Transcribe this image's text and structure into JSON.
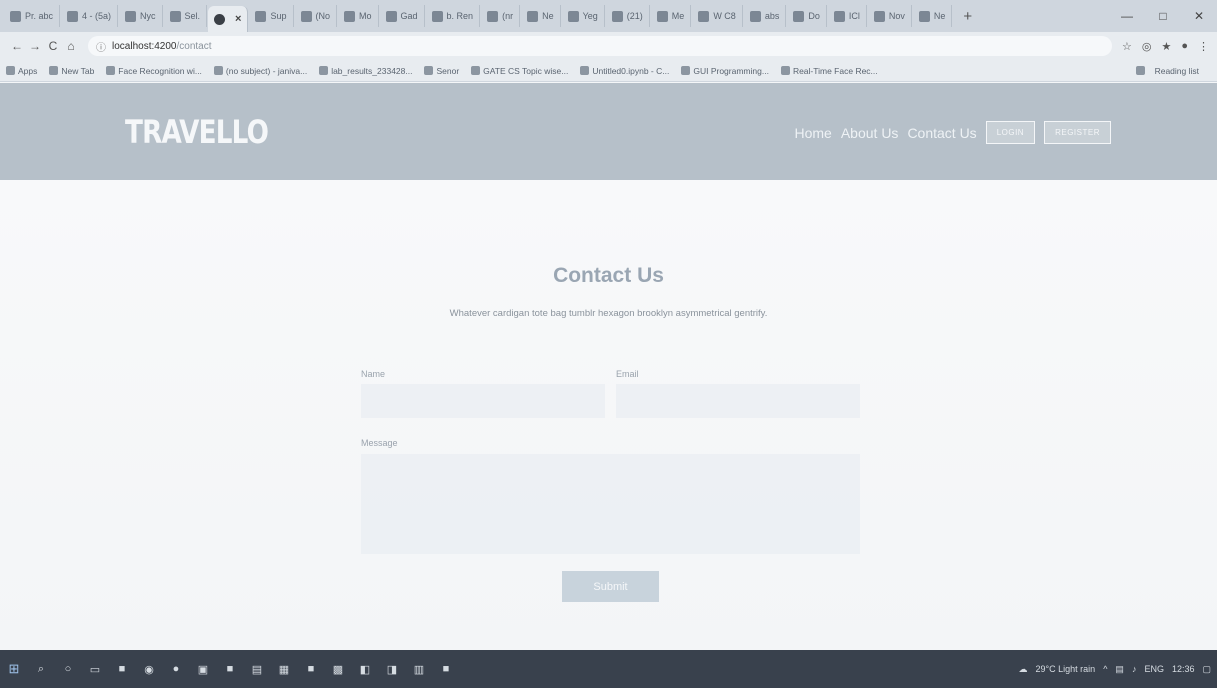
{
  "browser": {
    "tabs": [
      {
        "label": "Pr. abc"
      },
      {
        "label": "4 - (5a)"
      },
      {
        "label": "Nyc"
      },
      {
        "label": "Sel."
      },
      {
        "label": "",
        "active": true,
        "close": "×"
      },
      {
        "label": "Sup"
      },
      {
        "label": "(No"
      },
      {
        "label": "Mo"
      },
      {
        "label": "Gad"
      },
      {
        "label": "b. Ren"
      },
      {
        "label": "(nr"
      },
      {
        "label": "Ne"
      },
      {
        "label": "Yeg"
      },
      {
        "label": "(21)"
      },
      {
        "label": "Me"
      },
      {
        "label": "W C8"
      },
      {
        "label": "abs"
      },
      {
        "label": "Do"
      },
      {
        "label": "ICl"
      },
      {
        "label": "Nov"
      },
      {
        "label": "Ne"
      }
    ],
    "new_tab": "+",
    "window_controls": {
      "minimize": "—",
      "maximize": "□",
      "close": "✕"
    },
    "nav": {
      "back": "←",
      "forward": "→",
      "reload": "C",
      "home": "⌂"
    },
    "url_host": "localhost:4200",
    "url_path": "/contact",
    "bookmarks": [
      "Apps",
      "New Tab",
      "Face Recognition wi...",
      "(no subject) - janiva...",
      "lab_results_233428...",
      "Senor",
      "GATE CS Topic wise...",
      "Untitled0.ipynb - C...",
      "GUI Programming...",
      "Real-Time Face Rec..."
    ],
    "reading_list": "Reading list"
  },
  "site": {
    "logo": "TRAVELLO",
    "nav": {
      "home": "Home",
      "about": "About Us",
      "contact": "Contact Us",
      "login": "LOGIN",
      "register": "REGISTER"
    }
  },
  "contact": {
    "title": "Contact Us",
    "subtitle": "Whatever cardigan tote bag tumblr hexagon brooklyn asymmetrical gentrify.",
    "name_label": "Name",
    "email_label": "Email",
    "message_label": "Message",
    "submit_label": "Submit"
  },
  "taskbar": {
    "weather": "29°C Light rain",
    "language": "ENG",
    "time": "12:36"
  }
}
